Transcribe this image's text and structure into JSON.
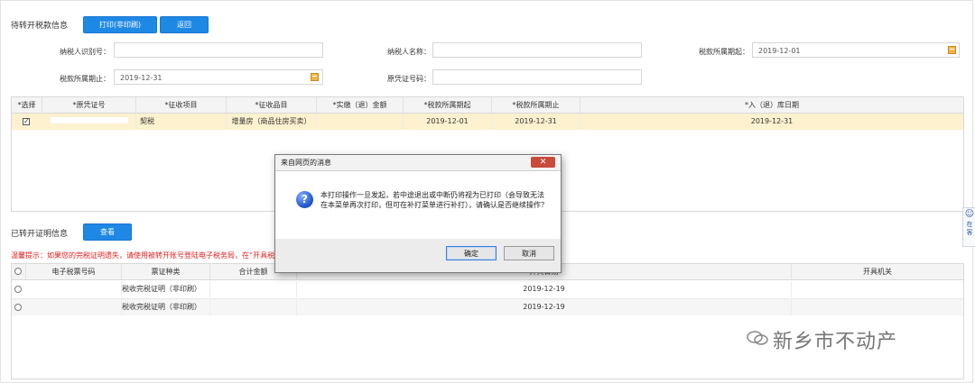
{
  "pending": {
    "title": "待转开税款信息",
    "print_btn": "打印(非印刷)",
    "back_btn": "返回"
  },
  "form": {
    "taxpayer_id_label": "纳税人识别号：",
    "taxpayer_id_value": "",
    "taxpayer_name_label": "纳税人名称：",
    "taxpayer_name_value": "",
    "period_start_label": "税款所属期起：",
    "period_start_value": "2019-12-01",
    "period_end_label": "税款所属期止：",
    "period_end_value": "2019-12-31",
    "voucher_no_label": "原凭证号码：",
    "voucher_no_value": ""
  },
  "table1": {
    "headers": [
      "*选择",
      "*原凭证号",
      "*征收项目",
      "*征收品目",
      "*实缴（退）金额",
      "*税款所属期起",
      "*税款所属期止",
      "*入（退）库日期"
    ],
    "rows": [
      {
        "voucher": "",
        "item": "契税",
        "sub_item": "增量房（商品住房买卖）",
        "amount": "",
        "start": "2019-12-01",
        "end": "2019-12-31",
        "date": "2019-12-31"
      }
    ]
  },
  "issued": {
    "title": "已转开证明信息",
    "view_btn": "查看",
    "warning": "温馨提示：如果您的完税证明遗失，请使用被转开账号登陆电子税务局，在“开具税收"
  },
  "table2": {
    "headers": [
      "电子税票号码",
      "票证种类",
      "合计金额",
      "开具日期",
      "开具机关"
    ],
    "rows": [
      {
        "no": "",
        "type": "税收完税证明（非印刷）",
        "amount": "",
        "date": "2019-12-19",
        "org": ""
      },
      {
        "no": "",
        "type": "税收完税证明（非印刷）",
        "amount": "",
        "date": "2019-12-19",
        "org": ""
      }
    ]
  },
  "dialog": {
    "title": "来自网页的消息",
    "close": "✕",
    "message": "本打印操作一旦发起，若中途退出或中断仍将视为已打印（会导致无法在本菜单再次打印，但可在补打菜单进行补打），请确认是否继续操作？",
    "ok": "确定",
    "cancel": "取消"
  },
  "side_widget": {
    "line1": "在",
    "line2": "客"
  },
  "watermark": "新乡市不动产"
}
